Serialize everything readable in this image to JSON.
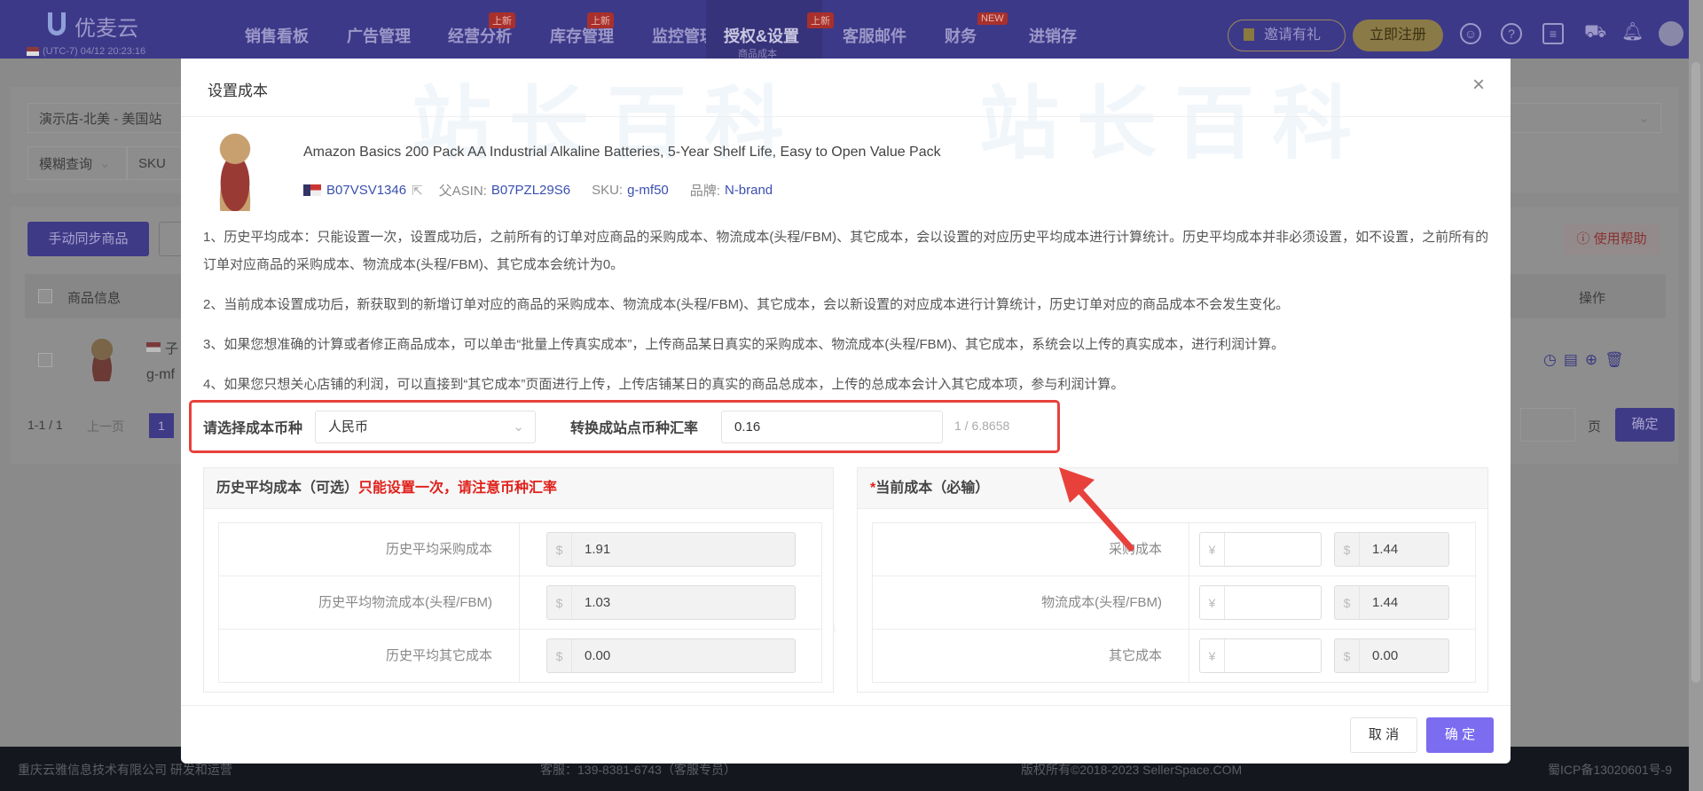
{
  "nav": {
    "logo": "优麦云",
    "datetime": "(UTC-7) 04/12 20:23:16",
    "items": [
      {
        "label": "销售看板"
      },
      {
        "label": "广告管理"
      },
      {
        "label": "经营分析",
        "badge": "上新"
      },
      {
        "label": "库存管理",
        "badge": "上新"
      },
      {
        "label": "监控管理"
      },
      {
        "label": "授权&设置",
        "badge": "上新",
        "sub": "商品成本"
      },
      {
        "label": "客服邮件"
      },
      {
        "label": "财务",
        "badge": "NEW"
      },
      {
        "label": "进销存"
      }
    ],
    "invite": "邀请有礼",
    "register": "立即注册"
  },
  "page": {
    "store_select": "演示店-北美 - 美国站",
    "query_mode": "模糊查询",
    "query_field": "SKU",
    "sync_button": "手动同步商品",
    "help_button": "使用帮助",
    "col_product": "商品信息",
    "col_actions": "操作",
    "row_prefix": "子",
    "row_sku": "g-mf",
    "pagination": {
      "range": "1-1 / 1",
      "prev": "上一页",
      "current": "1",
      "page_label": "页",
      "confirm": "确定"
    }
  },
  "modal": {
    "title": "设置成本",
    "watermark": "站长百科",
    "product": {
      "title": "Amazon Basics 200 Pack AA Industrial Alkaline Batteries, 5-Year Shelf Life, Easy to Open Value Pack",
      "asin": "B07VSV1346",
      "parent_asin_label": "父ASIN:",
      "parent_asin": "B07PZL29S6",
      "sku_label": "SKU:",
      "sku": "g-mf50",
      "brand_label": "品牌:",
      "brand": "N-brand"
    },
    "notes": [
      "1、历史平均成本：只能设置一次，设置成功后，之前所有的订单对应商品的采购成本、物流成本(头程/FBM)、其它成本，会以设置的对应历史平均成本进行计算统计。历史平均成本并非必须设置，如不设置，之前所有的订单对应商品的采购成本、物流成本(头程/FBM)、其它成本会统计为0。",
      "2、当前成本设置成功后，新获取到的新增订单对应的商品的采购成本、物流成本(头程/FBM)、其它成本，会以新设置的对应成本进行计算统计，历史订单对应的商品成本不会发生变化。",
      "3、如果您想准确的计算或者修正商品成本，可以单击“批量上传真实成本”，上传商品某日真实的采购成本、物流成本(头程/FBM)、其它成本，系统会以上传的真实成本，进行利润计算。",
      "4、如果您只想关心店铺的利润，可以直接到“其它成本”页面进行上传，上传店铺某日的真实的商品总成本，上传的总成本会计入其它成本项，参与利润计算。"
    ],
    "currency_label": "请选择成本币种",
    "currency_value": "人民币",
    "rate_label": "转换成站点币种汇率",
    "rate_value": "0.16",
    "rate_hint": "1 / 6.8658",
    "history": {
      "title": "历史平均成本（可选）",
      "warning": "只能设置一次，请注意币种汇率",
      "rows": [
        {
          "label": "历史平均采购成本",
          "prefix": "$",
          "value": "1.91"
        },
        {
          "label": "历史平均物流成本(头程/FBM)",
          "prefix": "$",
          "value": "1.03"
        },
        {
          "label": "历史平均其它成本",
          "prefix": "$",
          "value": "0.00"
        }
      ]
    },
    "current": {
      "required_mark": "*",
      "title": "当前成本（必输）",
      "rows": [
        {
          "label": "采购成本",
          "prefix": "¥",
          "input": "",
          "usd_prefix": "$",
          "usd": "1.44"
        },
        {
          "label": "物流成本(头程/FBM)",
          "prefix": "¥",
          "input": "",
          "usd_prefix": "$",
          "usd": "1.44"
        },
        {
          "label": "其它成本",
          "prefix": "¥",
          "input": "",
          "usd_prefix": "$",
          "usd": "0.00"
        }
      ]
    },
    "cancel": "取 消",
    "confirm": "确 定"
  },
  "footer": {
    "company": "重庆云雅信息技术有限公司 研发和运营",
    "support": "客服：139-8381-6743（客服专员）",
    "copyright": "版权所有©2018-2023 SellerSpace.COM",
    "icp": "蜀ICP备13020601号-9"
  },
  "colors": {
    "accent": "#7b6cf0",
    "warning": "#e0201b",
    "link": "#3a4fb0",
    "annotation": "#e8413c"
  }
}
